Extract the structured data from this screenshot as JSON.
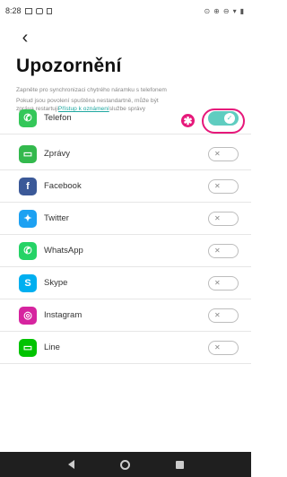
{
  "status_bar": {
    "time": "8:28"
  },
  "header": {
    "back_icon": "chevron-left-icon",
    "title": "Upozornění"
  },
  "description": {
    "line1": "Zapněte pro synchronizaci chytrého náramku s telefonem",
    "line2": "Pokud jsou povolení spuštěna nestandartně, může být",
    "line3_prefix": "zpráva restartuji",
    "line3_link": "Přístup k oznámení",
    "line3_suffix": "službe správy"
  },
  "annotation": {
    "label": "✱",
    "color": "#e6187a"
  },
  "apps": [
    {
      "name": "Telefon",
      "icon": "phone-icon",
      "color": "#34c759",
      "glyph": "✆",
      "enabled": true
    },
    {
      "name": "Zprávy",
      "icon": "message-icon",
      "color": "#33b94d",
      "glyph": "▭",
      "enabled": false
    },
    {
      "name": "Facebook",
      "icon": "facebook-icon",
      "color": "#3b5998",
      "glyph": "f",
      "enabled": false
    },
    {
      "name": "Twitter",
      "icon": "twitter-icon",
      "color": "#1da1f2",
      "glyph": "✦",
      "enabled": false
    },
    {
      "name": "WhatsApp",
      "icon": "whatsapp-icon",
      "color": "#25d366",
      "glyph": "✆",
      "enabled": false
    },
    {
      "name": "Skype",
      "icon": "skype-icon",
      "color": "#00aff0",
      "glyph": "S",
      "enabled": false
    },
    {
      "name": "Instagram",
      "icon": "instagram-icon",
      "color": "#d6249f",
      "glyph": "◎",
      "enabled": false
    },
    {
      "name": "Line",
      "icon": "line-icon",
      "color": "#00c300",
      "glyph": "▭",
      "enabled": false
    }
  ],
  "toggle_off_glyph": "✕",
  "toggle_on_glyph": "✓"
}
